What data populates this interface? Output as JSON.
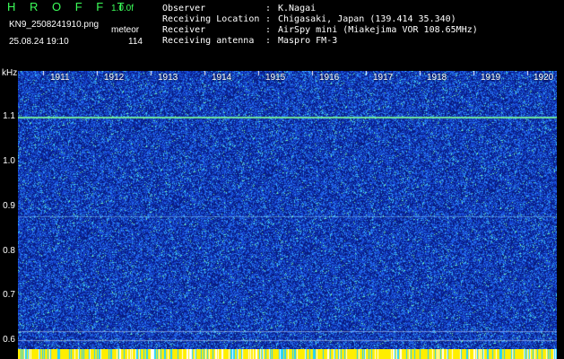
{
  "header": {
    "app_title": "H R O F F T",
    "version": "1.0.0f",
    "filename": "KN9_2508241910.png",
    "mode": "meteor",
    "datetime": "25.08.24 19:10",
    "count": "114"
  },
  "info": [
    {
      "key": "Observer",
      "value": "K.Nagai"
    },
    {
      "key": "Receiving Location",
      "value": "Chigasaki, Japan (139.414 35.340)"
    },
    {
      "key": "Receiver",
      "value": "AirSpy mini (Miakejima VOR 108.65MHz)"
    },
    {
      "key": "Receiving antenna",
      "value": "Maspro FM-3"
    }
  ],
  "axis": {
    "unit": "kHz",
    "y_labels": [
      "1.1",
      "1.0",
      "0.9",
      "0.8",
      "0.7",
      "0.6"
    ],
    "time_labels": [
      "1911",
      "1912",
      "1913",
      "1914",
      "1915",
      "1916",
      "1917",
      "1918",
      "1919",
      "1920"
    ]
  },
  "colors": {
    "background": "#000000",
    "spectrum_low": "#0a1f8a",
    "spectrum_mid": "#1e55e8",
    "spectrum_high": "#35d0ff",
    "carrier_line": "#7dff9a",
    "title_green": "#3cff5a",
    "bar_yellow": "#ffee00",
    "bar_cyan": "#20d0ff"
  }
}
